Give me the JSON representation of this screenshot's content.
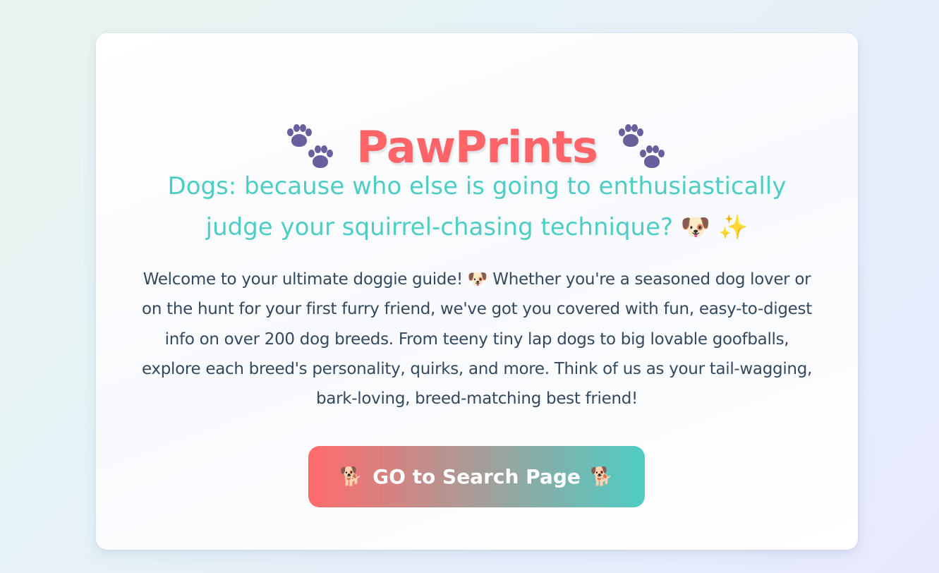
{
  "header": {
    "title": "PawPrints",
    "left_icon": "paw-prints-icon",
    "right_icon": "paw-prints-icon"
  },
  "tagline": {
    "text": "Dogs: because who else is going to enthusiastically judge your squirrel-chasing technique?",
    "emoji_1": "🐶",
    "emoji_2": "✨"
  },
  "description": {
    "before_emoji": "Welcome to your ultimate doggie guide!",
    "emoji": "🐶",
    "after_emoji": "Whether you're a seasoned dog lover or on the hunt for your first furry friend, we've got you covered with fun, easy-to-digest info on over 200 dog breeds. From teeny tiny lap dogs to big lovable goofballs, explore each breed's personality, quirks, and more. Think of us as your tail-wagging, bark-loving, breed-matching best friend!"
  },
  "cta": {
    "label": "GO to Search Page",
    "left_icon": "🐕",
    "right_icon": "🐕"
  },
  "colors": {
    "title": "#ff6468",
    "tagline": "#4ecdc4",
    "body_text": "#34495e",
    "paw": "#6a5e9c",
    "button_start": "#ff6b6b",
    "button_end": "#4ecdc4"
  }
}
